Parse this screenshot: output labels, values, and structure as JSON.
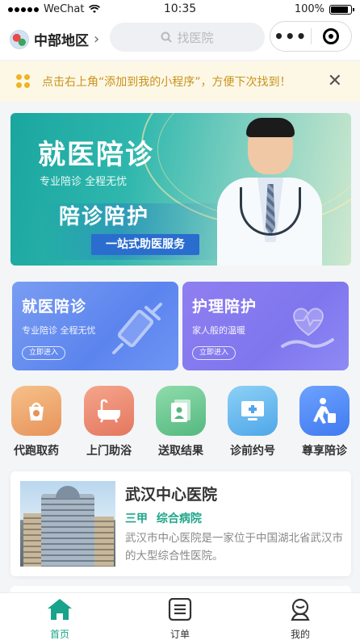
{
  "status_bar": {
    "carrier": "WeChat",
    "time": "10:35",
    "battery": "100%"
  },
  "nav": {
    "location": "中部地区",
    "search_placeholder": "找医院"
  },
  "notice": {
    "text": "点击右上角“添加到我的小程序”，方便下次找到！"
  },
  "banner": {
    "title": "就医陪诊",
    "subtitle": "专业陪诊 全程无忧",
    "headline": "陪诊陪护",
    "pill": "一站式助医服务"
  },
  "service_cards": [
    {
      "title": "就医陪诊",
      "subtitle": "专业陪诊 全程无忧",
      "button": "立即进入",
      "icon": "syringe-icon"
    },
    {
      "title": "护理陪护",
      "subtitle": "家人般的温暖",
      "button": "立即进入",
      "icon": "heart-hand-icon"
    }
  ],
  "quick_services": [
    {
      "label": "代跑取药",
      "icon": "medicine-bag-icon"
    },
    {
      "label": "上门助浴",
      "icon": "bathtub-icon"
    },
    {
      "label": "送取结果",
      "icon": "report-icon"
    },
    {
      "label": "诊前约号",
      "icon": "monitor-icon"
    },
    {
      "label": "尊享陪诊",
      "icon": "escort-person-icon"
    }
  ],
  "hospital": {
    "name": "武汉中心医院",
    "tags": "三甲 综合病院",
    "description": "武汉市中心医院是一家位于中国湖北省武汉市的大型综合性医院。"
  },
  "tabbar": [
    {
      "label": "首页",
      "icon": "home-icon",
      "active": true
    },
    {
      "label": "订单",
      "icon": "order-list-icon",
      "active": false
    },
    {
      "label": "我的",
      "icon": "profile-icon",
      "active": false
    }
  ],
  "colors": {
    "accent": "#19a38a",
    "notice_text": "#c8931b",
    "notice_bg": "#fdf7e6"
  }
}
